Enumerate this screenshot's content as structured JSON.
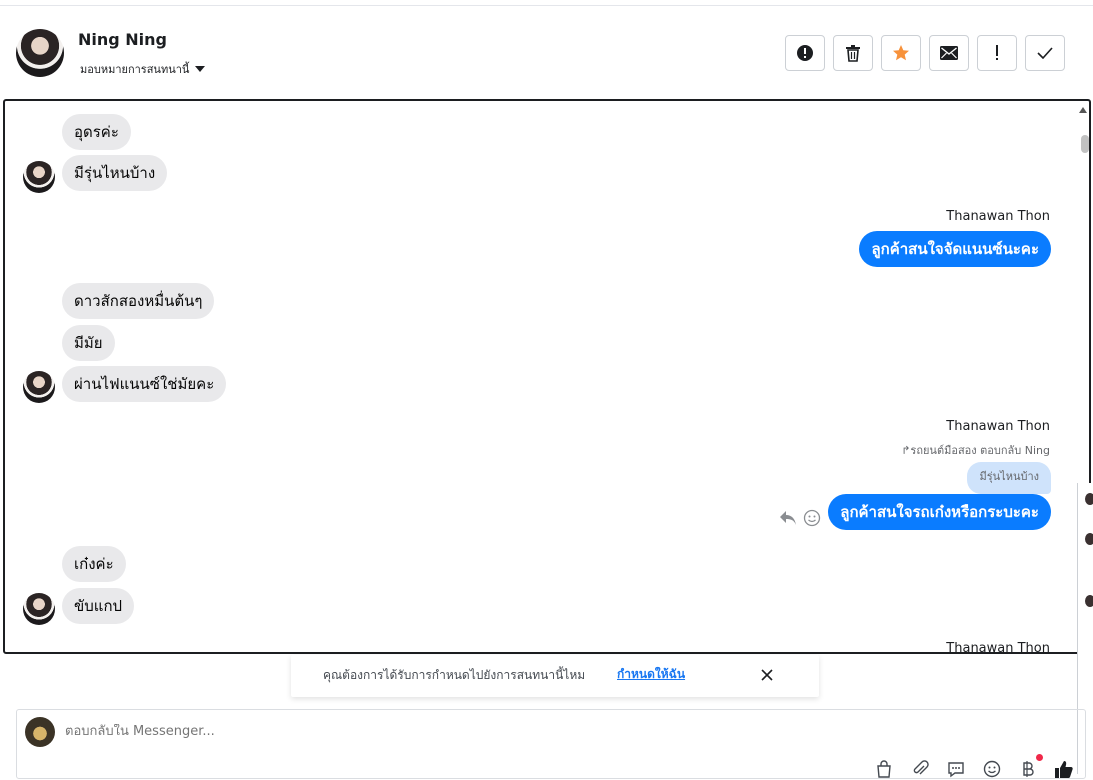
{
  "header": {
    "contact_name": "Ning Ning",
    "assign_label": "มอบหมายการสนทนานี้",
    "actions": [
      {
        "name": "report-button",
        "icon": "alert-circle-icon"
      },
      {
        "name": "delete-button",
        "icon": "trash-icon"
      },
      {
        "name": "star-button",
        "icon": "star-icon",
        "color": "#f7923b"
      },
      {
        "name": "mark-unread-button",
        "icon": "envelope-icon"
      },
      {
        "name": "important-button",
        "icon": "exclamation-icon"
      },
      {
        "name": "done-button",
        "icon": "check-icon"
      }
    ]
  },
  "messages": {
    "m1": "อุดรค่ะ",
    "m2": "มีรุ่นไหนบ้าง",
    "sender1": "Thanawan Thon",
    "o1": "ลูกค้าสนใจจัดแนนซ์นะคะ",
    "m3": "ดาวสักสองหมื่นต้นๆ",
    "m4": "มีมัย",
    "m5": "ผ่านไฟแนนซ์ใช่มัยคะ",
    "sender2": "Thanawan Thon",
    "reply_note": "รถยนต์มือสอง ตอบกลับ Ning",
    "quoted": "มีรุ่นไหนบ้าง",
    "o2": "ลูกค้าสนใจรถเก๋งหรือกระบะคะ",
    "m6": "เก๋งค่ะ",
    "m7": "ขับแกป",
    "sender3": "Thanawan Thon"
  },
  "toast": {
    "text": "คุณต้องการได้รับการกำหนดไปยังการสนทนานี้ไหม",
    "link": "กำหนดให้ฉัน"
  },
  "composer": {
    "placeholder": "ตอบกลับใน Messenger..."
  },
  "colors": {
    "accent": "#0a7cff",
    "incoming_bubble": "#e9e9eb",
    "link": "#1877f2"
  }
}
